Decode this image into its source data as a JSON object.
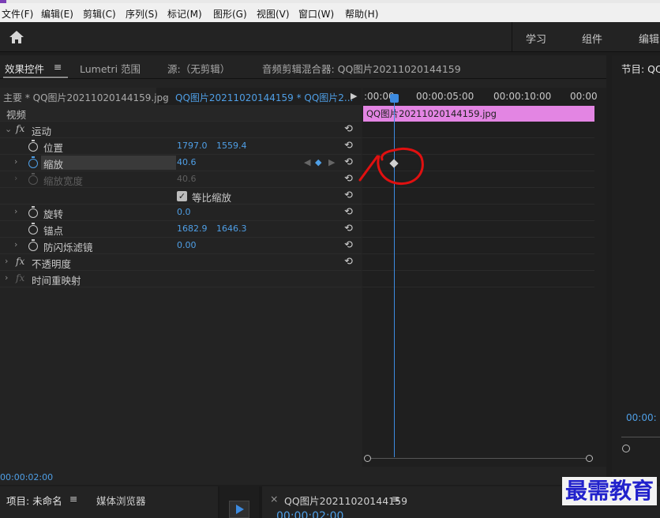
{
  "menu": [
    "文件(F)",
    "编辑(E)",
    "剪辑(C)",
    "序列(S)",
    "标记(M)",
    "图形(G)",
    "视图(V)",
    "窗口(W)",
    "帮助(H)"
  ],
  "workspaces": [
    "学习",
    "组件",
    "编辑"
  ],
  "panel_tabs": {
    "effects": "效果控件",
    "lumetri": "Lumetri 范围",
    "source": "源:（无剪辑）",
    "mixer": "音频剪辑混合器: QQ图片20211020144159"
  },
  "clip_bar": {
    "master": "主要 * QQ图片20211020144159.jpg",
    "sequence": "QQ图片20211020144159 * QQ图片2..."
  },
  "sections": {
    "video": "视频",
    "motion": "运动",
    "opacity": "不透明度",
    "time_remap": "时间重映射"
  },
  "props": {
    "position": {
      "label": "位置",
      "x": "1797.0",
      "y": "1559.4"
    },
    "scale": {
      "label": "缩放",
      "value": "40.6"
    },
    "scale_width": {
      "label": "缩放宽度",
      "value": "40.6"
    },
    "uniform": {
      "label": "等比缩放"
    },
    "rotation": {
      "label": "旋转",
      "value": "0.0"
    },
    "anchor": {
      "label": "锚点",
      "x": "1682.9",
      "y": "1646.3"
    },
    "flicker": {
      "label": "防闪烁滤镜",
      "value": "0.00"
    }
  },
  "ruler": {
    "t0": ":00:00",
    "t1": "00:00:05:00",
    "t2": "00:00:10:00",
    "t3": "00:00"
  },
  "clip_name": "QQ图片20211020144159.jpg",
  "timecode": "00:00:02:00",
  "program": {
    "title": "节目: QQ",
    "timecode": "00:00:"
  },
  "bottom": {
    "project": "项目: 未命名",
    "media": "媒体浏览器",
    "sequence": "QQ图片20211020144159",
    "timecode": "00:00:02:00"
  },
  "watermark": "最需教育",
  "colors": {
    "accent": "#4f9fe6",
    "clip": "#e385e3",
    "annotation": "#e01010"
  }
}
